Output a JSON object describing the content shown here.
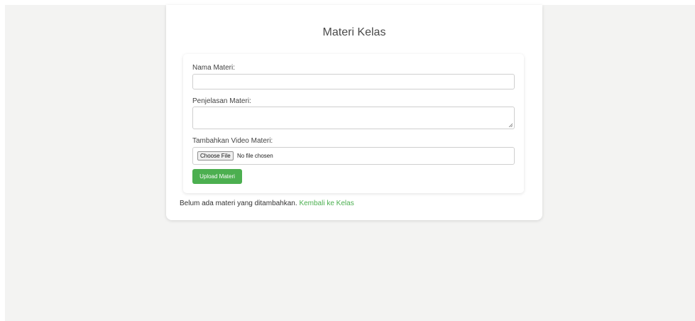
{
  "page": {
    "title": "Materi Kelas"
  },
  "form": {
    "nama_label": "Nama Materi:",
    "nama_value": "",
    "penjelasan_label": "Penjelasan Materi:",
    "penjelasan_value": "",
    "video_label": "Tambahkan Video Materi:",
    "choose_file_label": "Choose File",
    "no_file_text": "No file chosen",
    "upload_label": "Upload Materi"
  },
  "status": {
    "message": "Belum ada materi yang ditambahkan.",
    "back_link": "Kembali ke Kelas"
  },
  "colors": {
    "accent": "#4caf50",
    "background": "#f3f3f2",
    "card": "#ffffff"
  }
}
